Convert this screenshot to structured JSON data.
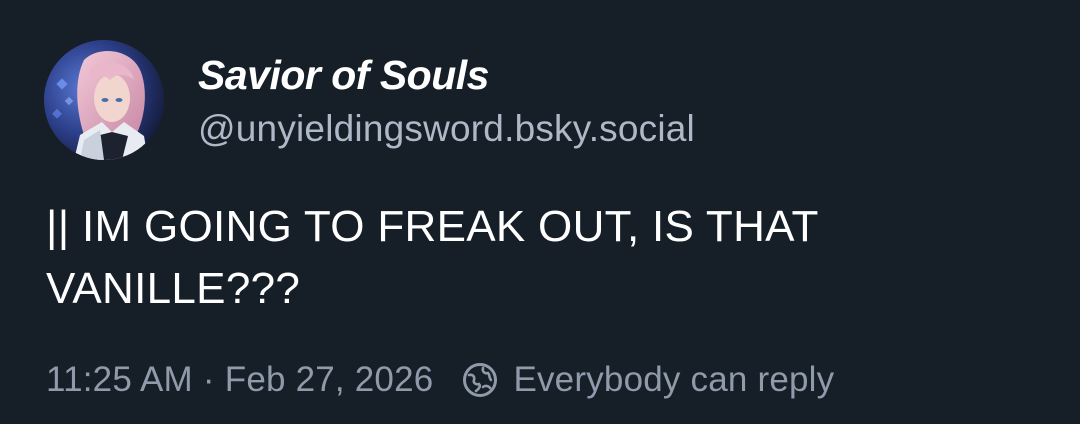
{
  "author": {
    "display_name": "Savior of Souls",
    "handle": "@unyieldingsword.bsky.social",
    "avatar_icon": "profile-avatar"
  },
  "post": {
    "text": "|| IM GOING TO FREAK OUT, IS THAT\nVANILLE???"
  },
  "meta": {
    "time": "11:25 AM",
    "separator": "·",
    "date": "Feb 27, 2026",
    "reply_icon": "globe-icon",
    "reply_setting": "Everybody can reply"
  },
  "colors": {
    "background": "#161e27",
    "primary_text": "#ffffff",
    "secondary_text": "#8f9bab",
    "handle_text": "#aeb9c8"
  }
}
